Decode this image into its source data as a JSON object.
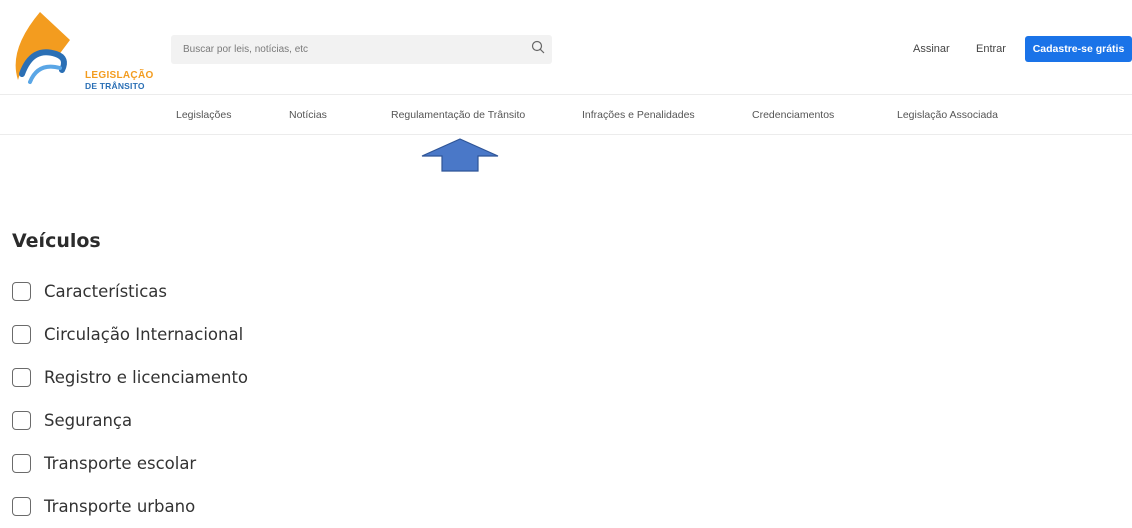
{
  "logo": {
    "line1": "LEGISLAÇÃO",
    "line2": "DE TRÂNSITO"
  },
  "search": {
    "placeholder": "Buscar por leis, notícias, etc",
    "icon": "search-icon"
  },
  "header": {
    "subscribe": "Assinar",
    "login": "Entrar",
    "signup": "Cadastre-se grátis"
  },
  "nav": {
    "items": [
      "Legislações",
      "Notícias",
      "Regulamentação de Trânsito",
      "Infrações e Penalidades",
      "Credenciamentos",
      "Legislação Associada"
    ]
  },
  "annotation": {
    "icon": "up-arrow-icon"
  },
  "colors": {
    "accent": "#1a73e8",
    "logo_orange": "#f39c1f",
    "logo_blue": "#2a6fb5",
    "arrow": "#4a78c8"
  },
  "filters": {
    "heading": "Veículos",
    "options": [
      "Características",
      "Circulação Internacional",
      "Registro e licenciamento",
      "Segurança",
      "Transporte escolar",
      "Transporte urbano"
    ]
  }
}
